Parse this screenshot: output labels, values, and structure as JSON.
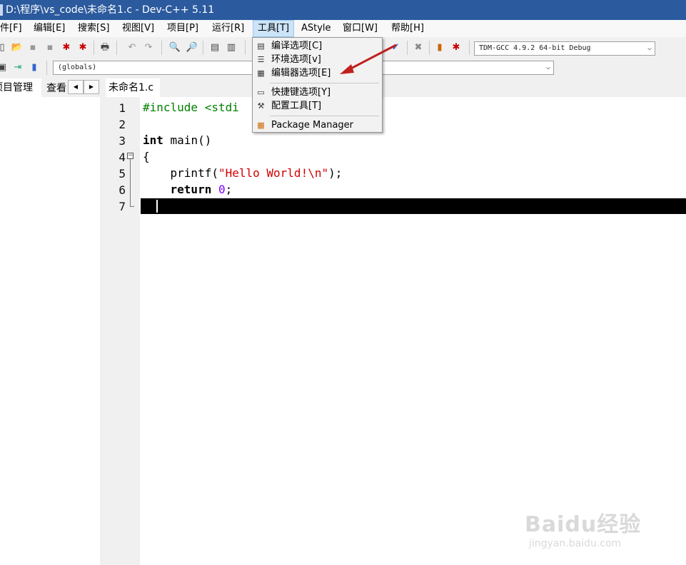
{
  "window": {
    "title": "D:\\程序\\vs_code\\未命名1.c - Dev-C++ 5.11"
  },
  "menu": [
    {
      "label": "件[F]"
    },
    {
      "label": "编辑[E]"
    },
    {
      "label": "搜索[S]"
    },
    {
      "label": "视图[V]"
    },
    {
      "label": "项目[P]"
    },
    {
      "label": "运行[R]"
    },
    {
      "label": "工具[T]"
    },
    {
      "label": "AStyle"
    },
    {
      "label": "窗口[W]"
    },
    {
      "label": "帮助[H]"
    }
  ],
  "toolbar": {
    "compiler_select": "TDM-GCC 4.9.2 64-bit Debug",
    "scope_select": "(globals)"
  },
  "left_panel": {
    "tab_project": "项目管理",
    "tab_class": "查看"
  },
  "editor": {
    "file_tab": "未命名1.c",
    "line_numbers": [
      "1",
      "2",
      "3",
      "4",
      "5",
      "6",
      "7"
    ],
    "line1": "#include <stdi",
    "line3_kw": "int",
    "line3_rest": " main()",
    "line4": "{",
    "line5_pre": "    printf(",
    "line5_str": "\"Hello World!\\n\"",
    "line5_post": ");",
    "line6_kw": "    return",
    "line6_num": "0",
    "line6_post": ";"
  },
  "tools_menu": {
    "items": [
      {
        "label": "编译选项[C]",
        "icon": "compiler-options-icon"
      },
      {
        "label": "环境选项[v]",
        "icon": "environment-options-icon"
      },
      {
        "label": "编辑器选项[E]",
        "icon": "editor-options-icon"
      },
      {
        "label": "快捷键选项[Y]",
        "icon": "shortcut-options-icon"
      },
      {
        "label": "配置工具[T]",
        "icon": "configure-tools-icon"
      },
      {
        "label": "Package Manager",
        "icon": "package-manager-icon"
      }
    ]
  },
  "annotation": {
    "arrow_color": "#c0201f"
  },
  "watermark": {
    "brand": "Baidu经验",
    "url": "jingyan.baidu.com"
  }
}
